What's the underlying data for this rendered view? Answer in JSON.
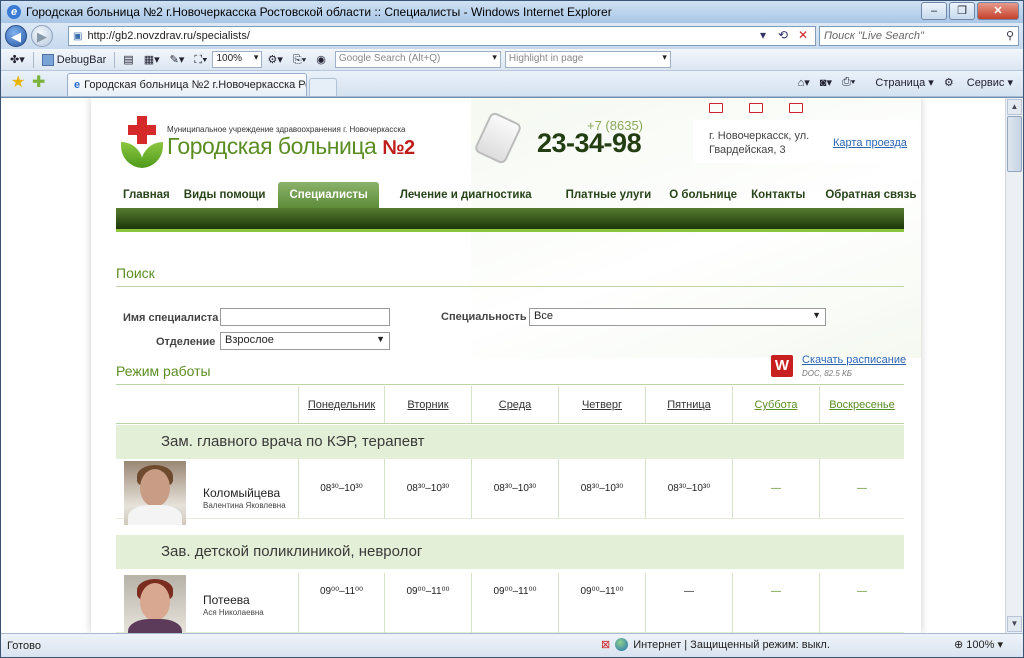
{
  "window": {
    "title": "Городская больница №2 г.Новочеркасска Ростовской области :: Специалисты - Windows Internet Explorer"
  },
  "address_bar": {
    "url": "http://gb2.novzdrav.ru/specialists/",
    "live_search_placeholder": "Поиск \"Live Search\""
  },
  "toolbar": {
    "debugbar": "DebugBar",
    "zoom": "100%",
    "google_search": "Google Search (Alt+Q)",
    "highlight": "Highlight in page"
  },
  "tabs": {
    "active_tab": "Городская больница №2 г.Новочеркасска Рост...",
    "page_menu": "Страница",
    "tools_menu": "Сервис"
  },
  "status": {
    "ready": "Готово",
    "zone": "Интернет | Защищенный режим: выкл.",
    "zoom": "100%"
  },
  "site": {
    "subtitle": "Муниципальное учреждение здравоохранения г. Новочеркасска",
    "name": "Городская больница",
    "name_num": "№2",
    "phone_code": "+7 (8635)",
    "phone_number": "23-34-98",
    "address": "г. Новочеркасск, ул. Гвардейская, 3",
    "map_link": "Карта проезда"
  },
  "nav": [
    "Главная",
    "Виды помощи",
    "Специалисты",
    "Лечение и диагностика",
    "Платные улуги",
    "О больнице",
    "Контакты",
    "Обратная связь"
  ],
  "search": {
    "title": "Поиск",
    "name_label": "Имя специалиста",
    "name_value": "",
    "specialty_label": "Специальность",
    "specialty_value": "Все",
    "dept_label": "Отделение",
    "dept_value": "Взрослое"
  },
  "schedule": {
    "title": "Режим работы",
    "download_label": "Скачать расписание",
    "download_meta": "DOC, 82.5 КБ",
    "days": [
      "Понедельник",
      "Вторник",
      "Среда",
      "Четверг",
      "Пятница",
      "Суббота",
      "Воскресенье"
    ],
    "groups": [
      {
        "title": "Зам. главного врача по КЭР, терапевт",
        "doctor_surname": "Коломыйцева",
        "doctor_name": "Валентина Яковлевна",
        "hours": [
          "08³⁰–10³⁰",
          "08³⁰–10³⁰",
          "08³⁰–10³⁰",
          "08³⁰–10³⁰",
          "08³⁰–10³⁰",
          "—",
          "—"
        ]
      },
      {
        "title": "Зав. детской поликлиникой, невролог",
        "doctor_surname": "Потеева",
        "doctor_name": "Ася Николаевна",
        "hours": [
          "09⁰⁰–11⁰⁰",
          "09⁰⁰–11⁰⁰",
          "09⁰⁰–11⁰⁰",
          "09⁰⁰–11⁰⁰",
          "—",
          "—",
          "—"
        ]
      }
    ]
  }
}
